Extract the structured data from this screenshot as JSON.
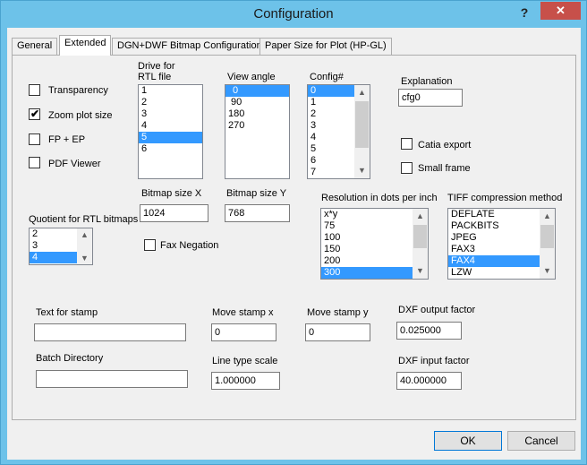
{
  "window": {
    "title": "Configuration",
    "help": "?",
    "close": "✕"
  },
  "tabs": [
    {
      "label": "General"
    },
    {
      "label": "Extended"
    },
    {
      "label": "DGN+DWF Bitmap Configuration"
    },
    {
      "label": "Paper Size for Plot (HP-GL)"
    }
  ],
  "checkboxes": {
    "transparency": {
      "label": "Transparency",
      "checked": false
    },
    "zoom": {
      "label": "Zoom plot size",
      "checked": true
    },
    "fpep": {
      "label": "FP + EP",
      "checked": false
    },
    "pdf": {
      "label": "PDF Viewer",
      "checked": false
    },
    "catia": {
      "label": "Catia export",
      "checked": false
    },
    "smallframe": {
      "label": "Small frame",
      "checked": false
    },
    "faxneg": {
      "label": "Fax Negation",
      "checked": false
    }
  },
  "drive": {
    "label_line1": "Drive for",
    "label_line2": "RTL file",
    "items": [
      "1",
      "2",
      "3",
      "4",
      "5",
      "6"
    ],
    "selected": "5"
  },
  "view_angle": {
    "label": "View angle",
    "items": [
      "0",
      "90",
      "180",
      "270"
    ],
    "selected": "0"
  },
  "config": {
    "label": "Config#",
    "items": [
      "0",
      "1",
      "2",
      "3",
      "4",
      "5",
      "6",
      "7"
    ],
    "selected": "0"
  },
  "explanation": {
    "label": "Explanation",
    "value": "cfg0"
  },
  "bitmap_x": {
    "label": "Bitmap size X",
    "value": "1024"
  },
  "bitmap_y": {
    "label": "Bitmap size Y",
    "value": "768"
  },
  "quotient": {
    "label": "Quotient for RTL bitmaps",
    "items": [
      "2",
      "3",
      "4"
    ],
    "selected": "4"
  },
  "resolution": {
    "label": "Resolution in dots per inch",
    "items": [
      "x*y",
      "75",
      "100",
      "150",
      "200",
      "300"
    ],
    "selected": "300"
  },
  "tiff": {
    "label": "TIFF compression method",
    "items": [
      "DEFLATE",
      "PACKBITS",
      "JPEG",
      "FAX3",
      "FAX4",
      "LZW"
    ],
    "selected": "FAX4"
  },
  "stamp_text": {
    "label": "Text for stamp",
    "value": ""
  },
  "move_x": {
    "label": "Move stamp x",
    "value": "0"
  },
  "move_y": {
    "label": "Move stamp y",
    "value": "0"
  },
  "dxf_out": {
    "label": "DXF output factor",
    "value": "0.025000"
  },
  "batch_dir": {
    "label": "Batch Directory",
    "value": ""
  },
  "line_scale": {
    "label": "Line type scale",
    "value": "1.000000"
  },
  "dxf_in": {
    "label": "DXF input factor",
    "value": "40.000000"
  },
  "buttons": {
    "ok": "OK",
    "cancel": "Cancel"
  }
}
